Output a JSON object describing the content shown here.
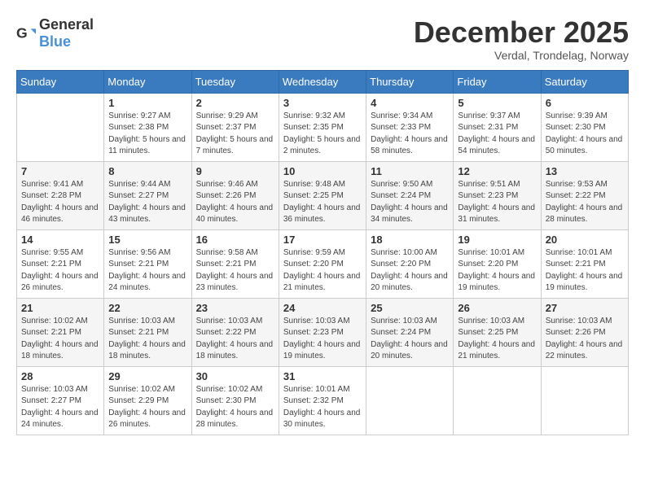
{
  "logo": {
    "general": "General",
    "blue": "Blue"
  },
  "title": "December 2025",
  "subtitle": "Verdal, Trondelag, Norway",
  "weekdays": [
    "Sunday",
    "Monday",
    "Tuesday",
    "Wednesday",
    "Thursday",
    "Friday",
    "Saturday"
  ],
  "weeks": [
    [
      {
        "day": "",
        "info": ""
      },
      {
        "day": "1",
        "info": "Sunrise: 9:27 AM\nSunset: 2:38 PM\nDaylight: 5 hours\nand 11 minutes."
      },
      {
        "day": "2",
        "info": "Sunrise: 9:29 AM\nSunset: 2:37 PM\nDaylight: 5 hours\nand 7 minutes."
      },
      {
        "day": "3",
        "info": "Sunrise: 9:32 AM\nSunset: 2:35 PM\nDaylight: 5 hours\nand 2 minutes."
      },
      {
        "day": "4",
        "info": "Sunrise: 9:34 AM\nSunset: 2:33 PM\nDaylight: 4 hours\nand 58 minutes."
      },
      {
        "day": "5",
        "info": "Sunrise: 9:37 AM\nSunset: 2:31 PM\nDaylight: 4 hours\nand 54 minutes."
      },
      {
        "day": "6",
        "info": "Sunrise: 9:39 AM\nSunset: 2:30 PM\nDaylight: 4 hours\nand 50 minutes."
      }
    ],
    [
      {
        "day": "7",
        "info": "Sunrise: 9:41 AM\nSunset: 2:28 PM\nDaylight: 4 hours\nand 46 minutes."
      },
      {
        "day": "8",
        "info": "Sunrise: 9:44 AM\nSunset: 2:27 PM\nDaylight: 4 hours\nand 43 minutes."
      },
      {
        "day": "9",
        "info": "Sunrise: 9:46 AM\nSunset: 2:26 PM\nDaylight: 4 hours\nand 40 minutes."
      },
      {
        "day": "10",
        "info": "Sunrise: 9:48 AM\nSunset: 2:25 PM\nDaylight: 4 hours\nand 36 minutes."
      },
      {
        "day": "11",
        "info": "Sunrise: 9:50 AM\nSunset: 2:24 PM\nDaylight: 4 hours\nand 34 minutes."
      },
      {
        "day": "12",
        "info": "Sunrise: 9:51 AM\nSunset: 2:23 PM\nDaylight: 4 hours\nand 31 minutes."
      },
      {
        "day": "13",
        "info": "Sunrise: 9:53 AM\nSunset: 2:22 PM\nDaylight: 4 hours\nand 28 minutes."
      }
    ],
    [
      {
        "day": "14",
        "info": "Sunrise: 9:55 AM\nSunset: 2:21 PM\nDaylight: 4 hours\nand 26 minutes."
      },
      {
        "day": "15",
        "info": "Sunrise: 9:56 AM\nSunset: 2:21 PM\nDaylight: 4 hours\nand 24 minutes."
      },
      {
        "day": "16",
        "info": "Sunrise: 9:58 AM\nSunset: 2:21 PM\nDaylight: 4 hours\nand 23 minutes."
      },
      {
        "day": "17",
        "info": "Sunrise: 9:59 AM\nSunset: 2:20 PM\nDaylight: 4 hours\nand 21 minutes."
      },
      {
        "day": "18",
        "info": "Sunrise: 10:00 AM\nSunset: 2:20 PM\nDaylight: 4 hours\nand 20 minutes."
      },
      {
        "day": "19",
        "info": "Sunrise: 10:01 AM\nSunset: 2:20 PM\nDaylight: 4 hours\nand 19 minutes."
      },
      {
        "day": "20",
        "info": "Sunrise: 10:01 AM\nSunset: 2:21 PM\nDaylight: 4 hours\nand 19 minutes."
      }
    ],
    [
      {
        "day": "21",
        "info": "Sunrise: 10:02 AM\nSunset: 2:21 PM\nDaylight: 4 hours\nand 18 minutes."
      },
      {
        "day": "22",
        "info": "Sunrise: 10:03 AM\nSunset: 2:21 PM\nDaylight: 4 hours\nand 18 minutes."
      },
      {
        "day": "23",
        "info": "Sunrise: 10:03 AM\nSunset: 2:22 PM\nDaylight: 4 hours\nand 18 minutes."
      },
      {
        "day": "24",
        "info": "Sunrise: 10:03 AM\nSunset: 2:23 PM\nDaylight: 4 hours\nand 19 minutes."
      },
      {
        "day": "25",
        "info": "Sunrise: 10:03 AM\nSunset: 2:24 PM\nDaylight: 4 hours\nand 20 minutes."
      },
      {
        "day": "26",
        "info": "Sunrise: 10:03 AM\nSunset: 2:25 PM\nDaylight: 4 hours\nand 21 minutes."
      },
      {
        "day": "27",
        "info": "Sunrise: 10:03 AM\nSunset: 2:26 PM\nDaylight: 4 hours\nand 22 minutes."
      }
    ],
    [
      {
        "day": "28",
        "info": "Sunrise: 10:03 AM\nSunset: 2:27 PM\nDaylight: 4 hours\nand 24 minutes."
      },
      {
        "day": "29",
        "info": "Sunrise: 10:02 AM\nSunset: 2:29 PM\nDaylight: 4 hours\nand 26 minutes."
      },
      {
        "day": "30",
        "info": "Sunrise: 10:02 AM\nSunset: 2:30 PM\nDaylight: 4 hours\nand 28 minutes."
      },
      {
        "day": "31",
        "info": "Sunrise: 10:01 AM\nSunset: 2:32 PM\nDaylight: 4 hours\nand 30 minutes."
      },
      {
        "day": "",
        "info": ""
      },
      {
        "day": "",
        "info": ""
      },
      {
        "day": "",
        "info": ""
      }
    ]
  ]
}
